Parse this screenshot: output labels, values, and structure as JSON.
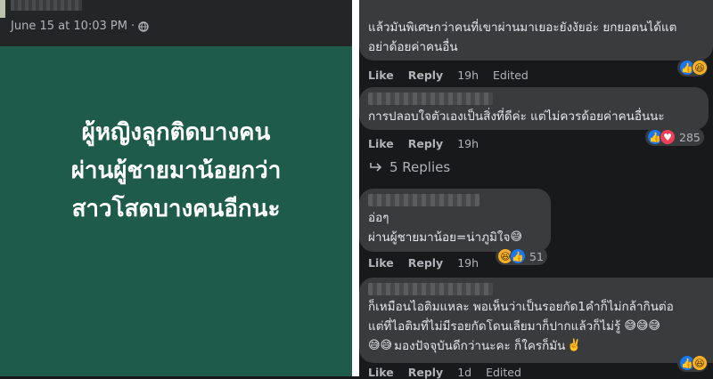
{
  "post": {
    "timestamp": "June 15 at 10:03 PM",
    "separator": "·",
    "privacy_icon": "globe-icon",
    "text_lines": [
      "ผู้หญิงลูกติดบางคน",
      "ผ่านผู้ชายมาน้อยกว่า",
      "สาวโสดบางคนอีกนะ"
    ],
    "background_color": "#1e5b4a"
  },
  "comments": [
    {
      "lines": [
        "แล้วมันพิเศษกว่าคนที่เขาผ่านมาเยอะยังงัยอ่ะ ยกยอตนได้แต",
        "อย่าด้อยค่าคนอื่น"
      ],
      "like": "Like",
      "reply": "Reply",
      "time": "19h",
      "edited": "Edited",
      "reactions": [
        "like",
        "haha"
      ]
    },
    {
      "lines": [
        "การปลอบใจตัวเองเป็นสิ่งที่ดีค่ะ แต่ไม่ควรด้อยค่าคนอื่นนะ"
      ],
      "like": "Like",
      "reply": "Reply",
      "time": "19h",
      "reactions": [
        "like",
        "love"
      ],
      "reaction_count": "285"
    },
    {
      "lines": [
        "อ่อๆ",
        "ผ่านผู้ชายมาน้อย=น่าภูมิใจ"
      ],
      "line_emoji": "😅",
      "like": "Like",
      "reply": "Reply",
      "time": "19h",
      "reactions": [
        "haha",
        "like"
      ],
      "reaction_count": "51"
    },
    {
      "lines": [
        "ก็เหมือนไอติมแหละ พอเห็นว่าเป็นรอยกัด1คำก็ไม่กล้ากินต่อ",
        "แต่ที่ไอติมที่ไม่มีรอยกัดโดนเลียมาก็ปากแล้วก็ไม่รู้",
        "มองปัจจุบันดีกว่านะคะ ก็ใครก็มัน"
      ],
      "line2_emoji": "😅😅😅",
      "line3_prefix": "😅😅",
      "line3_suffix": "✌️",
      "like": "Like",
      "reply": "Reply",
      "time": "1d",
      "edited": "Edited",
      "reactions": [
        "like",
        "haha"
      ]
    }
  ],
  "replies_link": "5 Replies",
  "replies_icon": "reply-arrow-icon"
}
